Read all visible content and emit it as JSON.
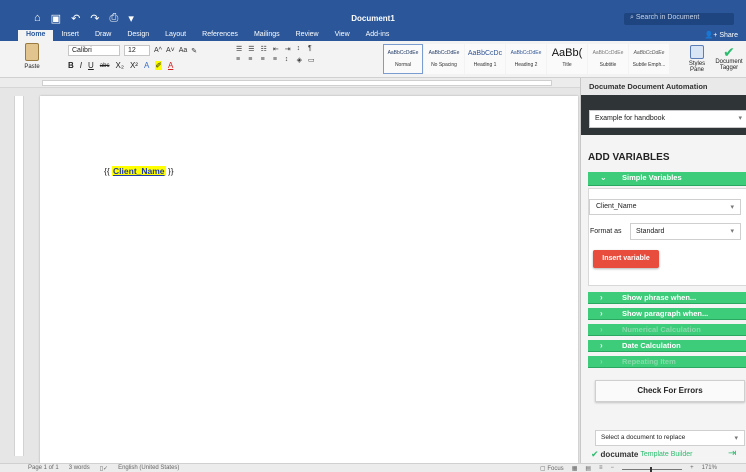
{
  "app": {
    "title": "Document1",
    "search_placeholder": "Search in Document",
    "quick_icons": [
      "⌂",
      "▣",
      "↶",
      "↷",
      "⎙",
      "▾"
    ]
  },
  "tabs": [
    "Home",
    "Insert",
    "Draw",
    "Design",
    "Layout",
    "References",
    "Mailings",
    "Review",
    "View",
    "Add-ins"
  ],
  "share_label": "Share",
  "ribbon": {
    "paste_label": "Paste",
    "font_name": "Calibri",
    "font_size": "12",
    "font_buttons": [
      "A^",
      "A˅",
      "Aa",
      "✎"
    ],
    "format_buttons": [
      "B",
      "I",
      "U",
      "abc",
      "X₂",
      "X²",
      "A",
      "✐",
      "A"
    ],
    "para_buttons": [
      "☰",
      "☰",
      "☷",
      "⇤",
      "⇥",
      "↕",
      "¶",
      "≡",
      "≡",
      "≡",
      "≡",
      "↕",
      "◈",
      "▭",
      "",
      ""
    ],
    "styles": [
      {
        "sample": "AaBbCcDdEe",
        "name": "Normal"
      },
      {
        "sample": "AaBbCcDdEe",
        "name": "No Spacing"
      },
      {
        "sample": "AaBbCcDc",
        "name": "Heading 1"
      },
      {
        "sample": "AaBbCcDdEe",
        "name": "Heading 2"
      },
      {
        "sample": "AaBb(",
        "name": "Title"
      },
      {
        "sample": "AaBbCcDdEe",
        "name": "Subtitle"
      },
      {
        "sample": "AaBbCcDdEe",
        "name": "Subtle Emph..."
      }
    ],
    "styles_pane_label": "Styles Pane",
    "doc_tagger_label": "Document Tagger"
  },
  "document": {
    "open_brace": "{{ ",
    "variable": "Client_Name",
    "close_brace": " }}"
  },
  "panel": {
    "header": "Documate Document Automation",
    "doc_select": "Example for handbook",
    "add_variables": "ADD VARIABLES",
    "simple_variables": "Simple Variables",
    "variable_select": "Client_Name",
    "format_label": "Format as",
    "format_value": "Standard",
    "insert_button": "Insert variable",
    "sections": [
      {
        "chev": "›",
        "label": "Show phrase when...",
        "dim": false
      },
      {
        "chev": "›",
        "label": "Show paragraph when...",
        "dim": false
      },
      {
        "chev": "›",
        "label": "Numerical Calculation",
        "dim": true
      },
      {
        "chev": "›",
        "label": "Date Calculation",
        "dim": false
      },
      {
        "chev": "›",
        "label": "Repeating Item",
        "dim": true
      }
    ],
    "check_errors": "Check For Errors",
    "replace_select": "Select a document to replace",
    "brand_name": "documate",
    "brand_suffix": "Template Builder"
  },
  "status": {
    "page": "Page 1 of 1",
    "words": "3 words",
    "language": "English (United States)",
    "focus": "Focus",
    "zoom": "171%"
  },
  "colors": {
    "word_blue": "#2b579a",
    "documate_green": "#3dcc7a",
    "insert_red": "#e84c3d",
    "highlight": "#ffff00"
  }
}
